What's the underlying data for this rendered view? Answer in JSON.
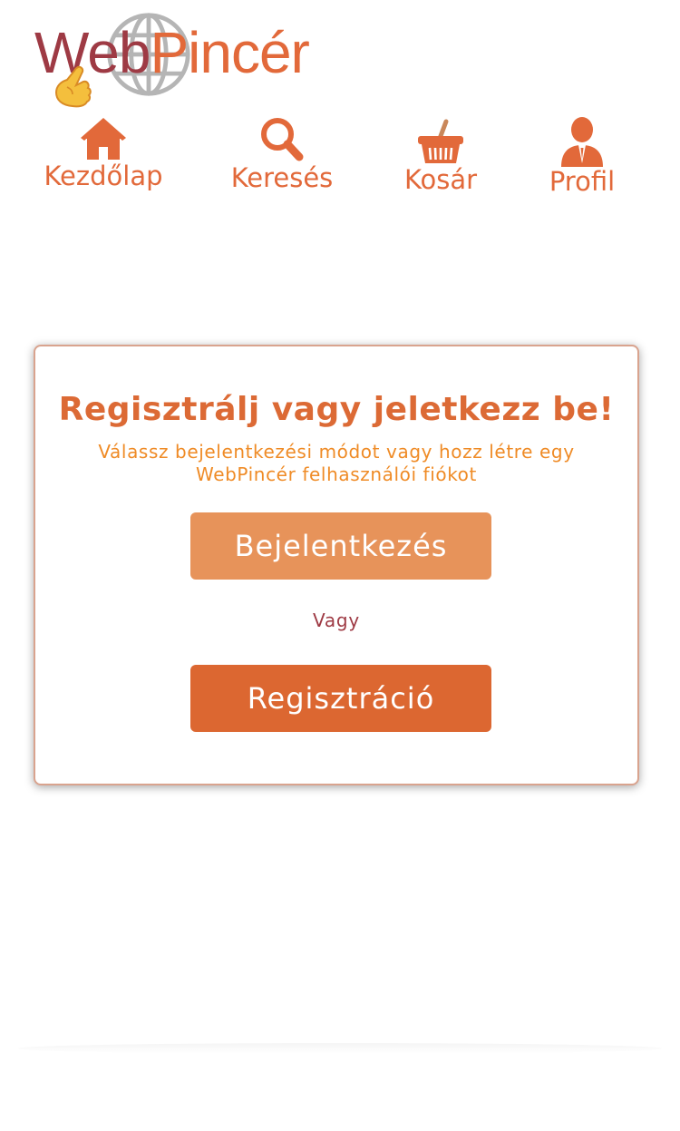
{
  "brand": {
    "name_part1": "Web",
    "name_part2": "Pincér",
    "color_primary": "#e2693a",
    "color_secondary": "#9e3a44"
  },
  "nav": {
    "items": [
      {
        "label": "Kezdőlap",
        "icon": "home-icon"
      },
      {
        "label": "Keresés",
        "icon": "search-icon"
      },
      {
        "label": "Kosár",
        "icon": "basket-icon"
      },
      {
        "label": "Profil",
        "icon": "user-icon"
      }
    ]
  },
  "auth_card": {
    "title": "Regisztrálj vagy jeletkezz be!",
    "subtitle": "Válassz bejelentkezési módot vagy hozz létre egy WebPincér felhasználói fiókot",
    "login_label": "Bejelentkezés",
    "or_label": "Vagy",
    "register_label": "Regisztráció"
  }
}
